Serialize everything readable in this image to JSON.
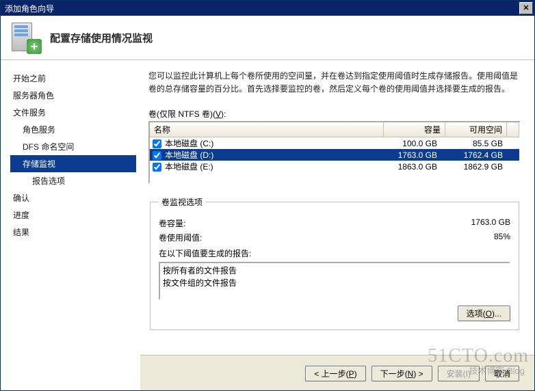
{
  "window": {
    "title": "添加角色向导"
  },
  "header": {
    "heading": "配置存储使用情况监视"
  },
  "sidebar": {
    "items": [
      {
        "label": "开始之前"
      },
      {
        "label": "服务器角色"
      },
      {
        "label": "文件服务"
      },
      {
        "label": "角色服务"
      },
      {
        "label": "DFS 命名空间"
      },
      {
        "label": "存储监视"
      },
      {
        "label": "报告选项"
      },
      {
        "label": "确认"
      },
      {
        "label": "进度"
      },
      {
        "label": "结果"
      }
    ]
  },
  "main": {
    "description": "您可以监控此计算机上每个卷所使用的空间量，并在卷达到指定使用阈值时生成存储报告。使用阈值是卷的总存储容量的百分比。首先选择要监控的卷，然后定义每个卷的使用阈值并选择要生成的报告。",
    "volumes_label_pre": "卷(仅限 NTFS 卷)(",
    "volumes_label_u": "V",
    "volumes_label_post": "):",
    "columns": {
      "name": "名称",
      "capacity": "容量",
      "free": "可用空间"
    },
    "rows": [
      {
        "checked": true,
        "name": "本地磁盘 (C:)",
        "capacity": "100.0 GB",
        "free": "85.5 GB"
      },
      {
        "checked": true,
        "name": "本地磁盘 (D:)",
        "capacity": "1763.0 GB",
        "free": "1762.4 GB"
      },
      {
        "checked": true,
        "name": "本地磁盘 (E:)",
        "capacity": "1863.0 GB",
        "free": "1862.9 GB"
      }
    ],
    "groupbox": {
      "legend": "卷监视选项",
      "capacity_label": "卷容量:",
      "capacity_value": "1763.0 GB",
      "threshold_label": "卷使用阈值:",
      "threshold_value": "85%",
      "reports_label": "在以下阈值要生成的报告:",
      "reports": [
        "按所有者的文件报告",
        "按文件组的文件报告"
      ],
      "options_btn_pre": "选项(",
      "options_btn_u": "O",
      "options_btn_post": ")..."
    }
  },
  "buttons": {
    "back_pre": "< 上一步(",
    "back_u": "P",
    "back_post": ")",
    "next_pre": "下一步(",
    "next_u": "N",
    "next_post": ") >",
    "install": "安装(I)",
    "cancel": "取消"
  },
  "watermark": {
    "line1": "51CTO.com",
    "line2": "技术博客  Blog"
  }
}
